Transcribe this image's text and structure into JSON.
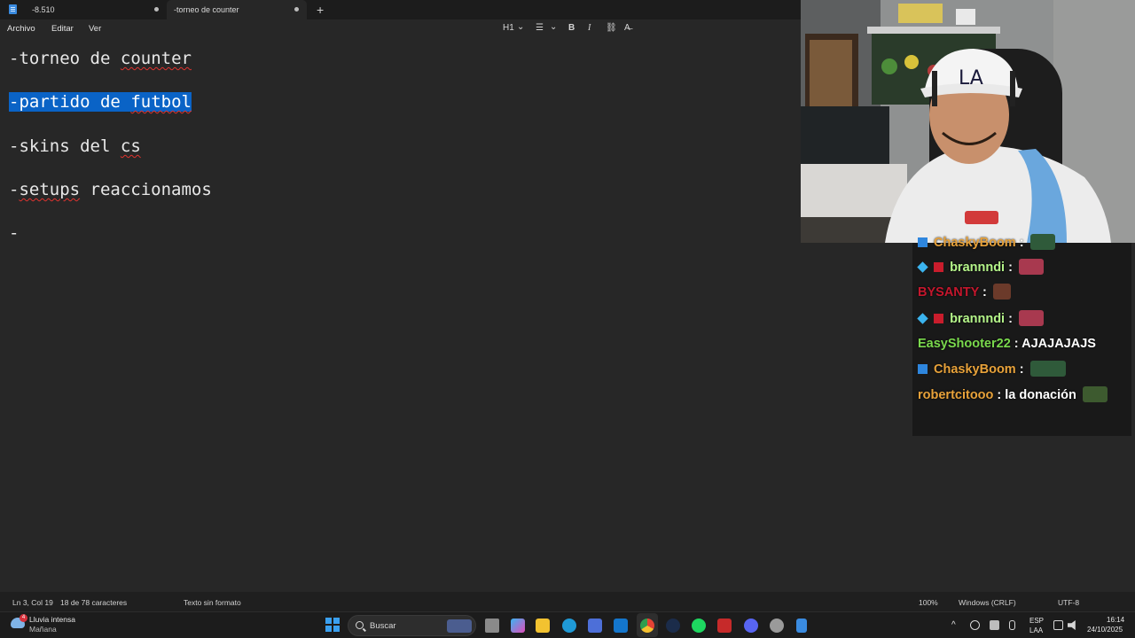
{
  "tabs": [
    {
      "label": "-8.510"
    },
    {
      "label": "-torneo de counter"
    }
  ],
  "new_tab_glyph": "+",
  "menu": {
    "file": "Archivo",
    "edit": "Editar",
    "view": "Ver"
  },
  "toolbar": {
    "heading": "H1",
    "heading_caret": "⌄",
    "list": "☰",
    "list_caret": "⌄",
    "bold": "B",
    "italic": "I",
    "link": "⛓",
    "clear": "A̶"
  },
  "editor": {
    "lines": [
      "-torneo de counter",
      "-partido de futbol",
      "-skins del cs",
      "-setups reaccionamos",
      "-"
    ],
    "line2_highlight": "selected",
    "spell_words": [
      "counter",
      "futbol",
      "cs",
      "setups"
    ]
  },
  "chat": {
    "messages": [
      {
        "user": "ChaskyBoom",
        "sep": " :",
        "text": "",
        "color": "#e8a23a"
      },
      {
        "user": "brannndi",
        "sep": " :",
        "text": "",
        "color": "#b5f58a"
      },
      {
        "user": "BYSANTY",
        "sep": " :",
        "text": "",
        "color": "#c4172d"
      },
      {
        "user": "brannndi",
        "sep": " :",
        "text": "",
        "color": "#b5f58a"
      },
      {
        "user": "EasyShooter22",
        "sep": " :",
        "text": " AJAJAJAJS",
        "color": "#7ad94d"
      },
      {
        "user": "ChaskyBoom",
        "sep": " :",
        "text": "",
        "color": "#e8a23a"
      },
      {
        "user": "robertcitooo",
        "sep": " :",
        "text": " la donación",
        "color": "#e8a23a"
      }
    ]
  },
  "status": {
    "position": "Ln 3, Col 19",
    "chars": "18 de 78 caracteres",
    "format": "Texto sin formato",
    "zoom": "100%",
    "eol": "Windows (CRLF)",
    "encoding": "UTF-8"
  },
  "taskbar": {
    "weather_title": "Lluvia intensa",
    "weather_sub": "Mañana",
    "weather_badge": "4",
    "search_label": "Buscar",
    "lang_top": "ESP",
    "lang_bottom": "LAA",
    "time": "16:14",
    "date": "24/10/2025",
    "overflow_glyph": "^"
  }
}
